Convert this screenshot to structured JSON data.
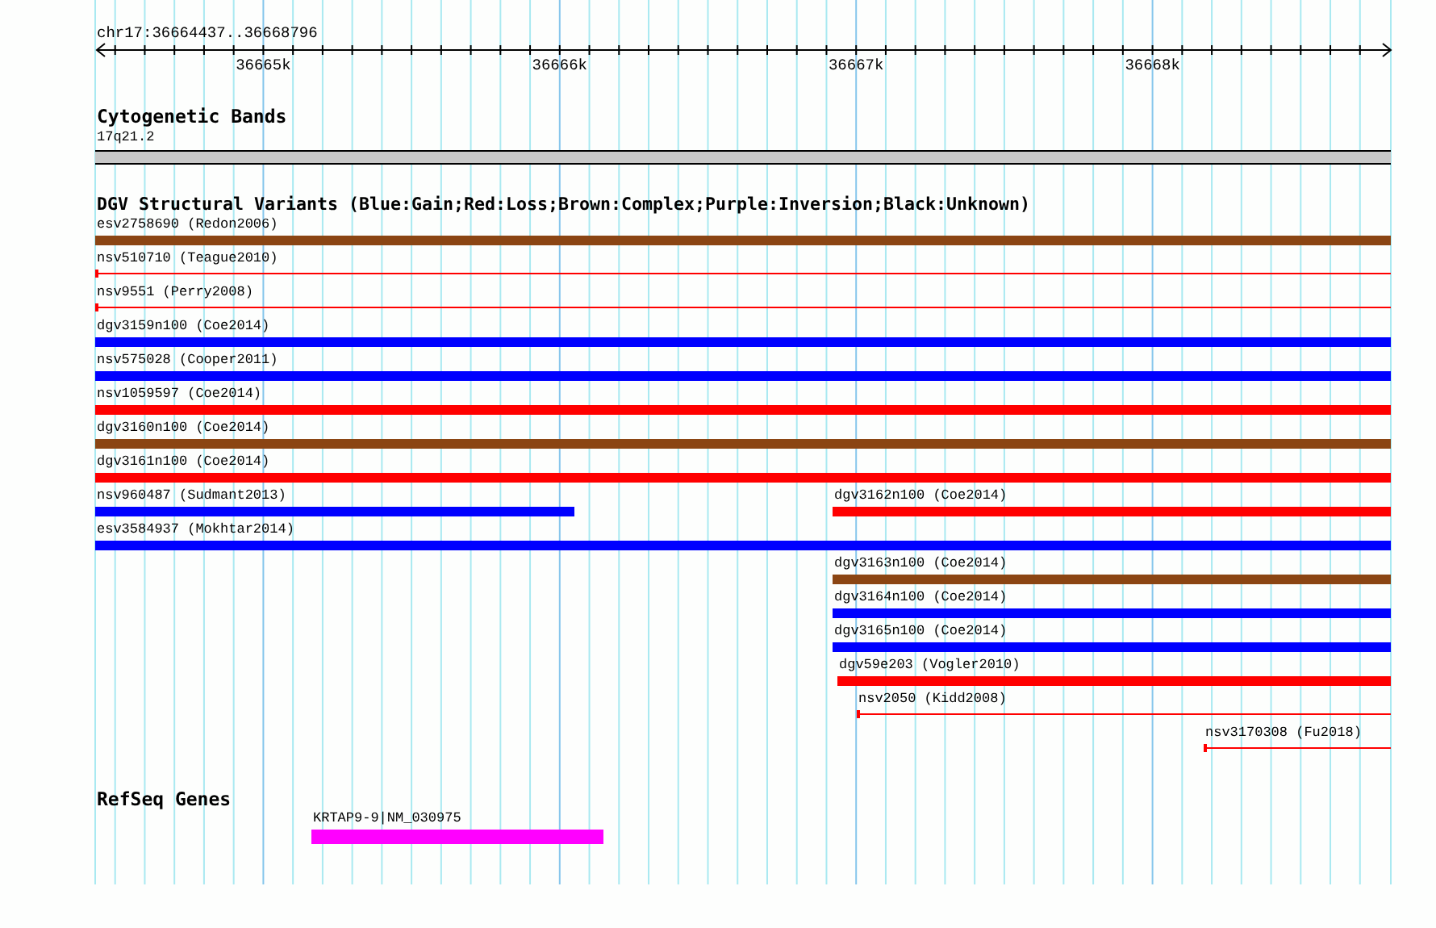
{
  "ruler": {
    "position": "chr17:36664437..36668796",
    "ticks": [
      "36665k",
      "36666k",
      "36667k",
      "36668k"
    ]
  },
  "tracks": [
    {
      "title": "Cytogenetic Bands",
      "kind": "bands",
      "features": [
        {
          "label": "17q21.2",
          "kind": "band",
          "color": "#c8c8c8"
        }
      ]
    },
    {
      "title": "DGV Structural Variants (Blue:Gain;Red:Loss;Brown:Complex;Purple:Inversion;Black:Unknown)",
      "kind": "variants",
      "features": [
        {
          "label": "esv2758690 (Redon2006)",
          "kind": "bar",
          "color": "#8b4513"
        },
        {
          "label": "nsv510710 (Teague2010)",
          "kind": "line",
          "color": "#ff0000"
        },
        {
          "label": "nsv9551 (Perry2008)",
          "kind": "line",
          "color": "#ff0000"
        },
        {
          "label": "dgv3159n100 (Coe2014)",
          "kind": "bar",
          "color": "#0000ff"
        },
        {
          "label": "nsv575028 (Cooper2011)",
          "kind": "bar",
          "color": "#0000ff"
        },
        {
          "label": "nsv1059597 (Coe2014)",
          "kind": "bar",
          "color": "#ff0000"
        },
        {
          "label": "dgv3160n100 (Coe2014)",
          "kind": "bar",
          "color": "#8b4513"
        },
        {
          "label": "dgv3161n100 (Coe2014)",
          "kind": "bar",
          "color": "#ff0000"
        },
        {
          "label": "nsv960487 (Sudmant2013)",
          "kind": "bar",
          "color": "#0000ff"
        },
        {
          "label": "dgv3162n100 (Coe2014)",
          "kind": "bar",
          "color": "#ff0000"
        },
        {
          "label": "esv3584937 (Mokhtar2014)",
          "kind": "bar",
          "color": "#0000ff"
        },
        {
          "label": "dgv3163n100 (Coe2014)",
          "kind": "bar",
          "color": "#8b4513"
        },
        {
          "label": "dgv3164n100 (Coe2014)",
          "kind": "bar",
          "color": "#0000ff"
        },
        {
          "label": "dgv3165n100 (Coe2014)",
          "kind": "bar",
          "color": "#0000ff"
        },
        {
          "label": "dgv59e203 (Vogler2010)",
          "kind": "bar",
          "color": "#ff0000"
        },
        {
          "label": "nsv2050 (Kidd2008)",
          "kind": "line",
          "color": "#ff0000"
        },
        {
          "label": "nsv3170308 (Fu2018)",
          "kind": "line",
          "color": "#ff0000"
        }
      ]
    },
    {
      "title": "RefSeq Genes",
      "kind": "genes",
      "features": [
        {
          "label": "KRTAP9-9|NM_030975",
          "kind": "bar",
          "color": "#ff00ff"
        }
      ]
    }
  ]
}
